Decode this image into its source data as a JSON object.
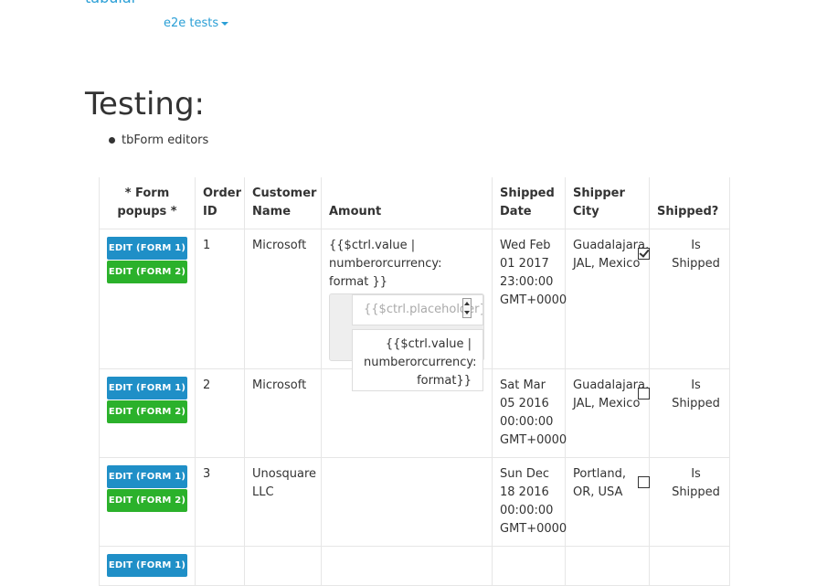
{
  "header": {
    "brand": "tabular",
    "dropdown_label": "e2e tests"
  },
  "page": {
    "title": "Testing:",
    "bullets": [
      "tbForm editors"
    ]
  },
  "grid": {
    "columns": [
      "* Form popups *",
      "Order ID",
      "Customer Name",
      "Amount",
      "Shipped Date",
      "Shipper City",
      "Shipped?"
    ],
    "buttons": {
      "form1": "EDIT (FORM 1)",
      "form2": "EDIT (FORM 2)"
    },
    "rows": [
      {
        "order_id": "1",
        "customer": "Microsoft",
        "amount": "{{$ctrl.value | numberorcurrency: format }}",
        "editor": {
          "placeholder": "{{$ctrl.placeholder}}",
          "display": "{{$ctrl.value | numberorcurrency: format}}"
        },
        "shipped_date": "Wed Feb 01 2017 23:00:00 GMT+0000",
        "city": "Guadalajara, JAL, Mexico",
        "shipped": true,
        "shipped_label": "Is Shipped"
      },
      {
        "order_id": "2",
        "customer": "Microsoft",
        "amount": "",
        "shipped_date": "Sat Mar 05 2016 00:00:00 GMT+0000",
        "city": "Guadalajara, JAL, Mexico",
        "shipped": false,
        "shipped_label": "Is Shipped"
      },
      {
        "order_id": "3",
        "customer": "Unosquare LLC",
        "amount": "",
        "shipped_date": "Sun Dec 18 2016 00:00:00 GMT+0000",
        "city": "Portland, OR, USA",
        "shipped": false,
        "shipped_label": "Is Shipped"
      }
    ]
  },
  "colors": {
    "link": "#2a9fd6",
    "button_form1": "#1f8fc7",
    "button_form2": "#2bb12b"
  }
}
